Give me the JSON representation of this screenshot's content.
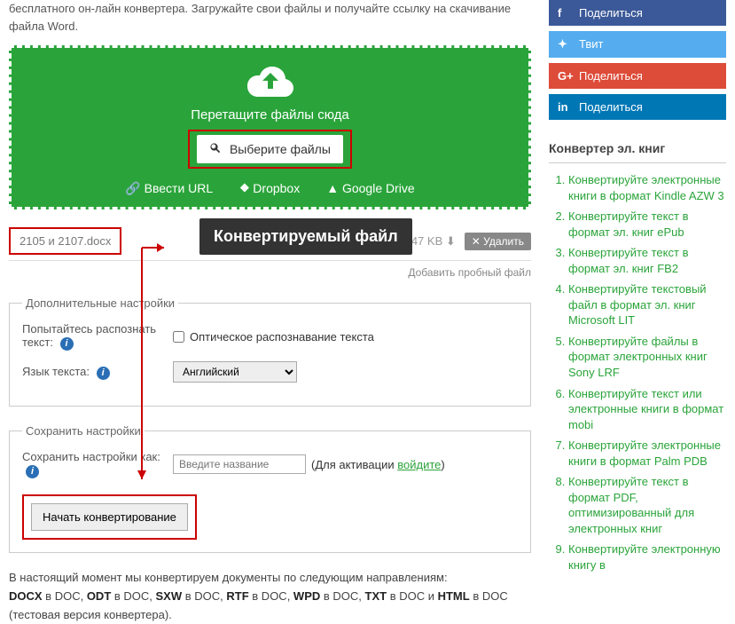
{
  "intro": "бесплатного он-лайн конвертера. Загружайте свои файлы и получайте ссылку на скачивание файла Word.",
  "dropzone": {
    "drag_text": "Перетащите файлы сюда",
    "choose_label": "Выберите файлы",
    "url_label": "Ввести URL",
    "dropbox_label": "Dropbox",
    "gdrive_label": "Google Drive"
  },
  "file": {
    "name": "2105 и 2107.docx",
    "size": "24.47 KB",
    "delete_label": "Удалить",
    "tooltip": "Конвертируемый файл",
    "add_more": "Добавить пробный файл"
  },
  "settings": {
    "legend": "Дополнительные настройки",
    "ocr_try_label": "Попытайтесь распознать текст:",
    "ocr_cb_label": "Оптическое распознавание текста",
    "lang_label": "Язык текста:",
    "lang_value": "Английский"
  },
  "save": {
    "legend": "Сохранить настройки",
    "as_label": "Сохранить настройки как:",
    "placeholder": "Введите название",
    "hint_pre": "(Для активации ",
    "login": "войдите",
    "hint_post": ")"
  },
  "start_label": "Начать конвертирование",
  "footer": {
    "line1": "В настоящий момент мы конвертируем документы по следующим направлениям:",
    "b1": "DOCX",
    "t1": " в DOC, ",
    "b2": "ODT",
    "t2": " в DOC, ",
    "b3": "SXW",
    "t3": " в DOC, ",
    "b4": "RTF",
    "t4": " в DOC, ",
    "b5": "WPD",
    "t5": " в DOC, ",
    "b6": "TXT",
    "t6": " в DOC и ",
    "b7": "HTML",
    "t7": " в DOC (тестовая версия конвертера)."
  },
  "share": {
    "fb": "Поделиться",
    "tw": "Твит",
    "gp": "Поделиться",
    "in": "Поделиться"
  },
  "sidebar": {
    "title": "Конвертер эл. книг",
    "items": [
      "Конвертируйте электронные книги в формат Kindle AZW 3",
      "Конвертируйте текст в формат эл. книг ePub",
      "Конвертируйте текст в формат эл. книг FB2",
      "Конвертируйте текстовый файл в формат эл. книг Microsoft LIT",
      "Конвертируйте файлы в формат электронных книг Sony LRF",
      "Конвертируйте текст или электронные книги в формат mobi",
      "Конвертируйте электронные книги в формат Palm PDB",
      "Конвертируйте текст в формат PDF, оптимизированный для электронных книг",
      "Конвертируйте электронную книгу в"
    ]
  }
}
